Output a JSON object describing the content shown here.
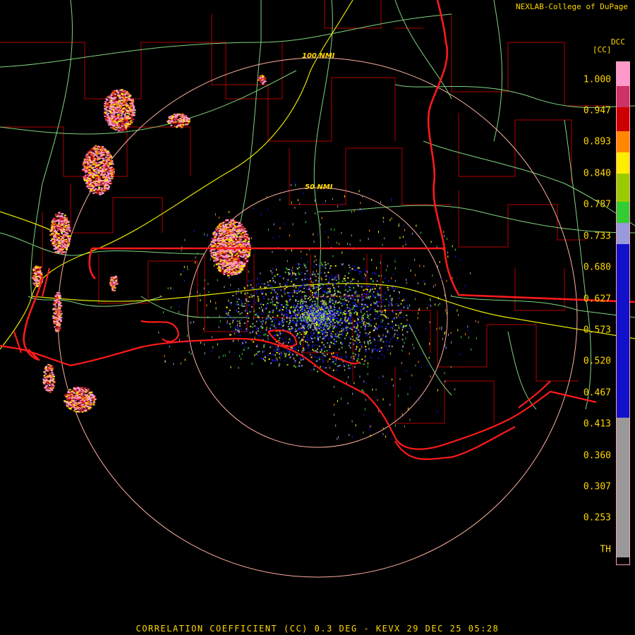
{
  "header": {
    "credit": "NEXLAB-College of DuPage",
    "product_code": "DCC",
    "units": "[CC]"
  },
  "footer": {
    "caption": "CORRELATION COEFFICIENT (CC) 0.3 DEG - KEVX 29 DEC 25 05:28"
  },
  "range_rings": [
    {
      "label": "50 NMI"
    },
    {
      "label": "100 NMI"
    }
  ],
  "colorbar": {
    "labels": [
      "1.000",
      "0.947",
      "0.893",
      "0.840",
      "0.787",
      "0.733",
      "0.680",
      "0.627",
      "0.573",
      "0.520",
      "0.467",
      "0.413",
      "0.360",
      "0.307",
      "0.253",
      "TH"
    ],
    "colors": {
      "pink": "#ff99cc",
      "magenta": "#cc3366",
      "red": "#cc0000",
      "orange": "#ff8800",
      "yellow": "#ffee00",
      "lime": "#99cc00",
      "green": "#33cc33",
      "lavender": "#9999dd",
      "blue": "#1111cc",
      "gray": "#999999"
    }
  },
  "map_colors": {
    "state_borders": "#ff1a1a",
    "county_borders": "#b00000",
    "highways": "#e6e600",
    "roads": "#7fd47f",
    "range_rings": "#ffb0a0"
  }
}
